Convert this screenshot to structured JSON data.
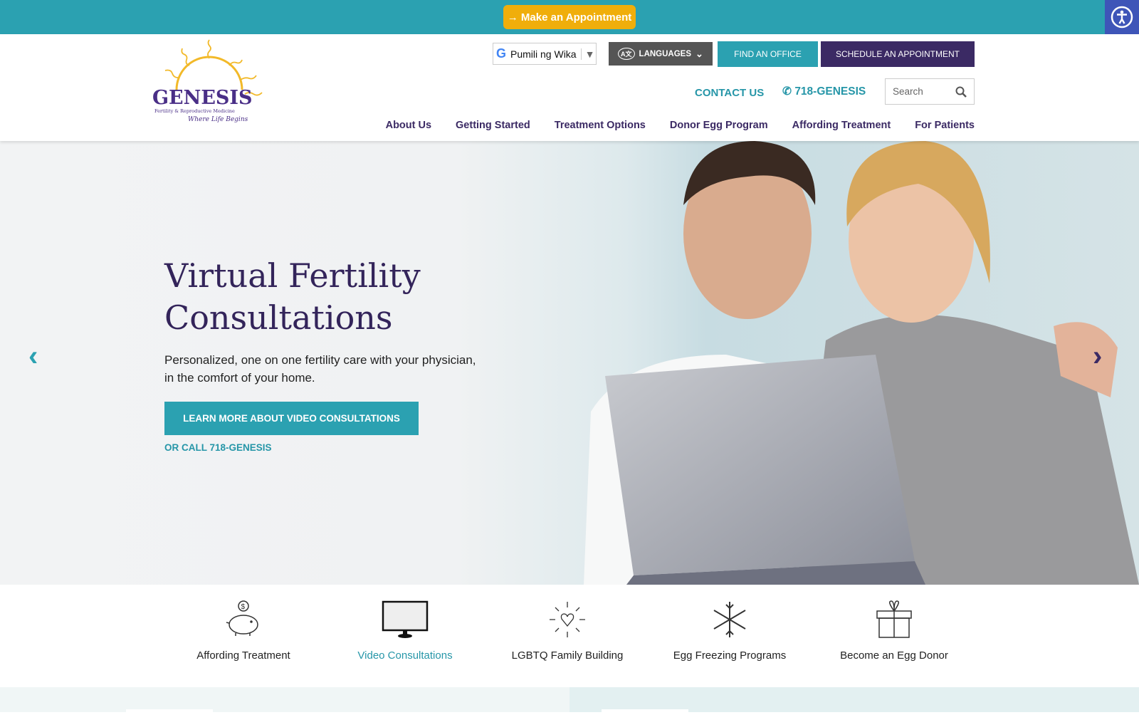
{
  "topbar": {
    "appointment": "→ Make an Appointment",
    "accessibility_icon": "accessibility-icon"
  },
  "header": {
    "logo_text": "GENESIS",
    "logo_sub": "Fertility & Reproductive Medicine",
    "logo_tag": "Where Life Begins",
    "translate_select": "Pumili ng Wika",
    "languages": "LANGUAGES",
    "find_office": "FIND AN OFFICE",
    "schedule": "SCHEDULE AN APPOINTMENT",
    "contact": "CONTACT US",
    "phone": "718-GENESIS",
    "search_placeholder": "Search"
  },
  "nav": [
    "About Us",
    "Getting Started",
    "Treatment Options",
    "Donor Egg Program",
    "Affording Treatment",
    "For Patients"
  ],
  "hero": {
    "title_line1": "Virtual Fertility",
    "title_line2": "Consultations",
    "para_line1": "Personalized, one on one fertility care with your physician,",
    "para_line2": "in the comfort of your home.",
    "button": "LEARN MORE ABOUT VIDEO CONSULTATIONS",
    "call": "OR CALL 718-GENESIS"
  },
  "features": [
    {
      "label": "Affording Treatment",
      "icon": "piggy-bank-icon"
    },
    {
      "label": "Video Consultations",
      "icon": "monitor-icon",
      "active": true
    },
    {
      "label": "LGBTQ Family Building",
      "icon": "heart-icon"
    },
    {
      "label": "Egg Freezing Programs",
      "icon": "snowflake-icon"
    },
    {
      "label": "Become an Egg Donor",
      "icon": "gift-icon"
    }
  ],
  "colors": {
    "teal": "#2ba1b1",
    "purple": "#3b2a64",
    "gold": "#f0ae0b",
    "accessibility": "#3e55b8"
  }
}
